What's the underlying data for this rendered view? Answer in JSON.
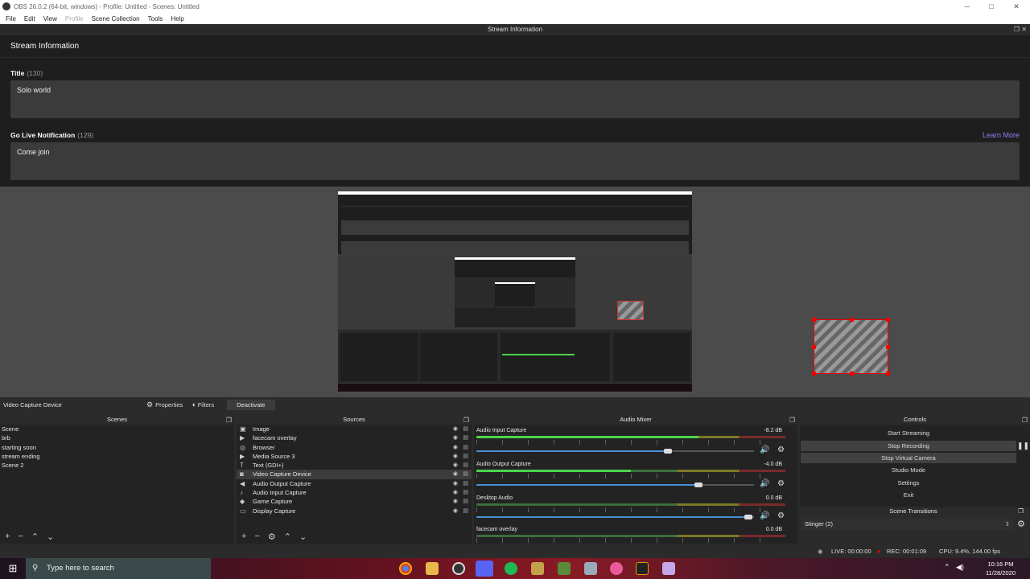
{
  "window": {
    "title": "OBS 26.0.2 (64-bit, windows) - Profile: Untitled - Scenes: Untitled",
    "minimize": "─",
    "maximize": "□",
    "close": "✕"
  },
  "menu": [
    "File",
    "Edit",
    "View",
    "Profile",
    "Scene Collection",
    "Tools",
    "Help"
  ],
  "dock_title": "Stream Information",
  "stream_info": {
    "heading": "Stream Information",
    "title_label": "Title",
    "title_count": "(130)",
    "title_value": "Solo world",
    "notif_label": "Go Live Notification",
    "notif_count": "(129)",
    "notif_value": "Come join",
    "learn_more": "Learn More"
  },
  "context_bar": {
    "source": "Video Capture Device",
    "properties": "Properties",
    "filters": "Filters",
    "deactivate": "Deactivate"
  },
  "scenes": {
    "title": "Scenes",
    "items": [
      "Scene",
      "brb",
      "starting soon",
      "stream ending",
      "Scene 2"
    ]
  },
  "sources": {
    "title": "Sources",
    "items": [
      "Image",
      "facecam overlay",
      "Browser",
      "Media Source 3",
      "Text (GDI+)",
      "Video Capture Device",
      "Audio Output Capture",
      "Audio Input Capture",
      "Game Capture",
      "Display Capture"
    ]
  },
  "mixer": {
    "title": "Audio Mixer",
    "channels": [
      {
        "name": "Audio Input Capture",
        "db": "-8.2 dB",
        "volume": 0.69,
        "level": 0.72
      },
      {
        "name": "Audio Output Capture",
        "db": "-4.0 dB",
        "volume": 0.8,
        "level": 0.5
      },
      {
        "name": "Desktop Audio",
        "db": "0.0 dB",
        "volume": 0.98,
        "level": 0
      },
      {
        "name": "facecam overlay",
        "db": "0.0 dB",
        "volume": 0.98,
        "level": 0
      }
    ]
  },
  "controls": {
    "title": "Controls",
    "start_streaming": "Start Streaming",
    "stop_recording": "Stop Recording",
    "stop_virtual_camera": "Stop Virtual Camera",
    "studio_mode": "Studio Mode",
    "settings": "Settings",
    "exit": "Exit"
  },
  "transitions": {
    "title": "Scene Transitions",
    "selected": "Stinger (2)"
  },
  "status": {
    "live": "LIVE: 00:00:00",
    "rec": "REC: 00:01:09",
    "cpu": "CPU: 9.4%, 144.00 fps"
  },
  "taskbar": {
    "search_placeholder": "Type here to search",
    "time": "10:16 PM",
    "date": "11/28/2020"
  },
  "colors": {
    "accent": "#9b7cf0",
    "rec": "#e00000",
    "selection": "#ff0000"
  }
}
